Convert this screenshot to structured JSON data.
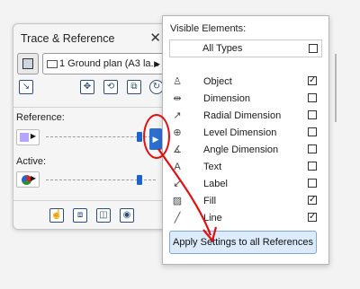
{
  "palette": {
    "title": "Trace & Reference",
    "close_glyph": "✕",
    "view_name": "1 Ground plan (A3 la...",
    "reference_label": "Reference:",
    "active_label": "Active:",
    "reference_slider_level": 0.83,
    "active_slider_level": 0.83
  },
  "popup": {
    "title": "Visible Elements:",
    "all_types_label": "All Types",
    "all_types_checked": false,
    "items": [
      {
        "label": "Object",
        "icon": "object-icon",
        "checked": true
      },
      {
        "label": "Dimension",
        "icon": "dimension-icon",
        "checked": false
      },
      {
        "label": "Radial Dimension",
        "icon": "radial-dimension-icon",
        "checked": false
      },
      {
        "label": "Level Dimension",
        "icon": "level-dimension-icon",
        "checked": false
      },
      {
        "label": "Angle Dimension",
        "icon": "angle-dimension-icon",
        "checked": false
      },
      {
        "label": "Text",
        "icon": "text-icon",
        "checked": false
      },
      {
        "label": "Label",
        "icon": "label-icon",
        "checked": false
      },
      {
        "label": "Fill",
        "icon": "fill-icon",
        "checked": true
      },
      {
        "label": "Line",
        "icon": "line-icon",
        "checked": true
      }
    ],
    "apply_label": "Apply Settings to all References"
  },
  "colors": {
    "accent_blue": "#2d6fd0",
    "annotation_red": "#e01010",
    "reference_swatch": "#b7a6ff"
  }
}
